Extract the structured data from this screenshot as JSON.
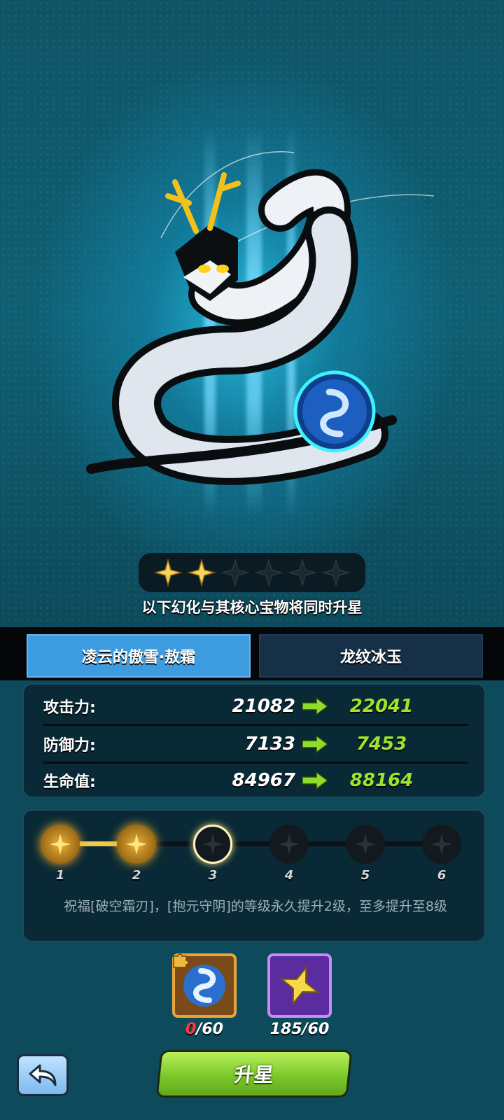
{
  "hero": {
    "stars_total": 6,
    "stars_filled": 2,
    "note": "以下幻化与其核心宝物将同时升星"
  },
  "tabs": [
    {
      "label": "凌云的傲雪·敖霜",
      "active": true
    },
    {
      "label": "龙纹冰玉",
      "active": false
    }
  ],
  "stats": [
    {
      "label": "攻击力:",
      "old": "21082",
      "new": "22041"
    },
    {
      "label": "防御力:",
      "old": "7133",
      "new": "7453"
    },
    {
      "label": "生命值:",
      "old": "84967",
      "new": "88164"
    }
  ],
  "progress": {
    "nodes": [
      "1",
      "2",
      "3",
      "4",
      "5",
      "6"
    ],
    "reached": 2,
    "current": 3,
    "blessing": "祝福[破空霜刃]，[抱元守阴]的等级永久提升2级，至多提升至8级"
  },
  "materials": [
    {
      "icon": "dragon-jade-icon",
      "have": "0",
      "need": "/60"
    },
    {
      "icon": "star-crystal-icon",
      "count": "185/60"
    }
  ],
  "buttons": {
    "upgrade": "升星",
    "back_icon": "back-arrow-icon"
  },
  "colors": {
    "accent_green": "#9be52b",
    "tab_active": "#3d9be0",
    "star_gold": "#f2c84d"
  }
}
